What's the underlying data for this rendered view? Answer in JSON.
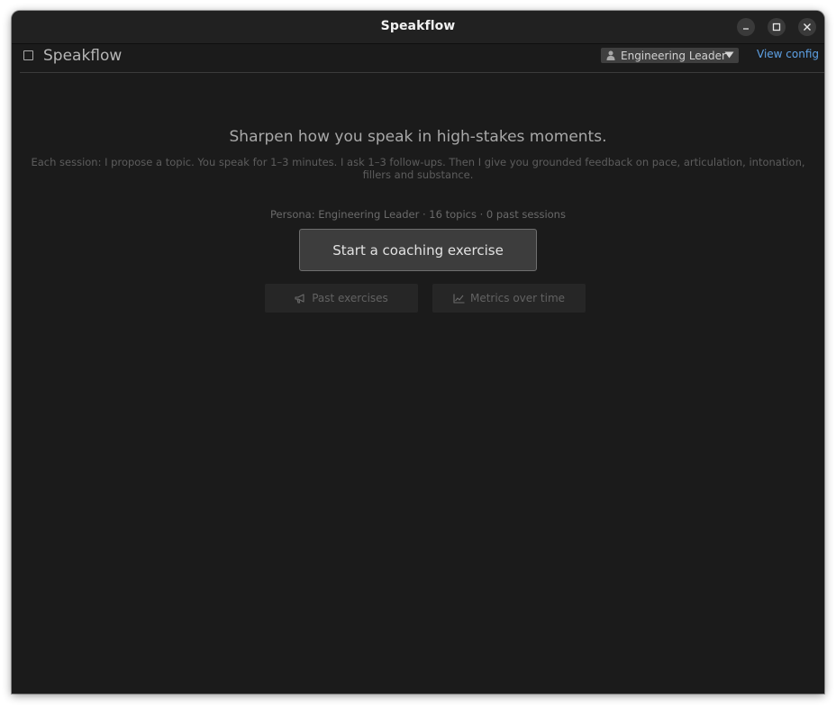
{
  "window": {
    "title": "Speakflow",
    "controls": [
      "minimize-icon",
      "maximize-icon",
      "close-icon"
    ]
  },
  "appbar": {
    "brand": "Speakflow",
    "persona_selected": "Engineering Leader",
    "view_config_label": "View config"
  },
  "main": {
    "headline": "Sharpen how you speak in high-stakes moments.",
    "description": "Each session: I propose a topic. You speak for 1–3 minutes. I ask 1–3 follow-ups. Then I give you grounded feedback on pace, articulation, intonation, fillers and substance.",
    "meta": "Persona: Engineering Leader · 16 topics · 0 past sessions",
    "start_button": "Start a coaching exercise",
    "past_button": "Past exercises",
    "metrics_button": "Metrics over time"
  },
  "colors": {
    "window_bg": "#1b1b1b",
    "titlebar_bg": "#212121",
    "link": "#5ea2e6",
    "primary_button_bg": "#3d3d3d"
  }
}
